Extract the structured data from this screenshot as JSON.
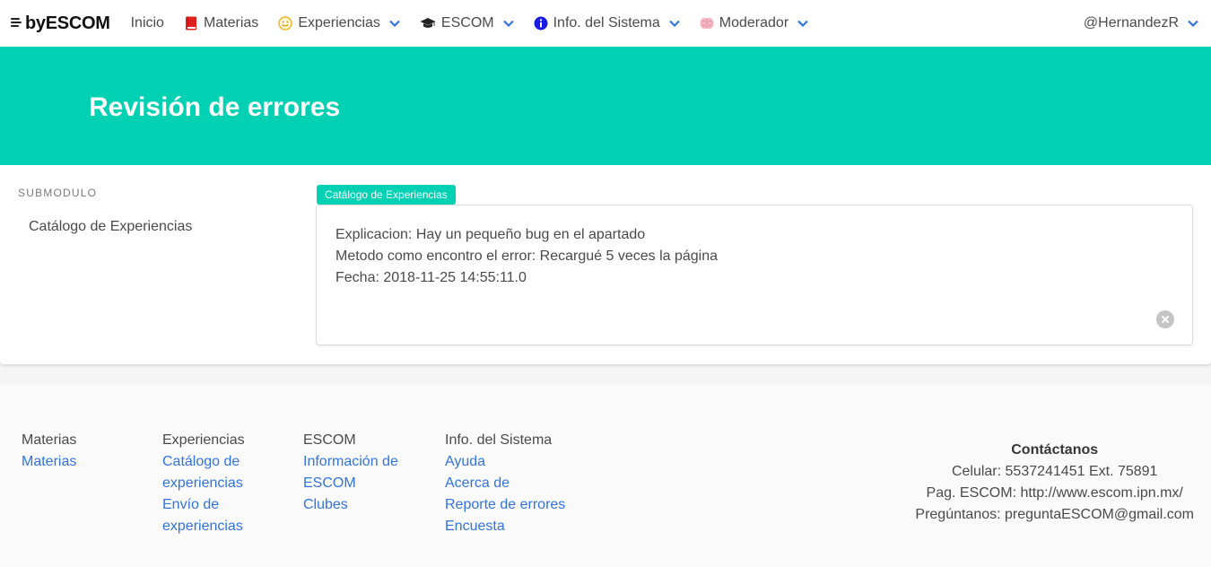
{
  "navbar": {
    "brand": "byESCOM",
    "items": [
      {
        "label": "Inicio",
        "icon": "",
        "dropdown": false
      },
      {
        "label": "Materias",
        "icon": "book-icon",
        "dropdown": false
      },
      {
        "label": "Experiencias",
        "icon": "smile-icon",
        "dropdown": true
      },
      {
        "label": "ESCOM",
        "icon": "graduation-cap-icon",
        "dropdown": true
      },
      {
        "label": "Info. del Sistema",
        "icon": "info-icon",
        "dropdown": true
      },
      {
        "label": "Moderador",
        "icon": "brain-icon",
        "dropdown": true
      }
    ],
    "user": "@HernandezR"
  },
  "hero": {
    "title": "Revisión de errores"
  },
  "sidebar": {
    "label": "SUBMODULO",
    "items": [
      {
        "label": "Catálogo de Experiencias"
      }
    ]
  },
  "report": {
    "tag": "Catálogo de Experiencias",
    "lines": [
      "Explicacion: Hay un pequeño bug en el apartado",
      "Metodo como encontro el error: Recargué 5 veces la página",
      "Fecha: 2018-11-25 14:55:11.0"
    ]
  },
  "footer": {
    "columns": [
      {
        "heading": "Materias",
        "links": [
          "Materias"
        ]
      },
      {
        "heading": "Experiencias",
        "links": [
          "Catálogo de",
          "experiencias",
          "Envío de",
          "experiencias"
        ]
      },
      {
        "heading": "ESCOM",
        "links": [
          "Información de",
          "ESCOM",
          "Clubes"
        ]
      },
      {
        "heading": "Info. del Sistema",
        "links": [
          "Ayuda",
          "Acerca de",
          "Reporte de errores",
          "Encuesta"
        ]
      }
    ],
    "contact": {
      "heading": "Contáctanos",
      "lines": [
        "Celular: 5537241451 Ext. 75891",
        "Pag. ESCOM: http://www.escom.ipn.mx/",
        "Pregúntanos: preguntaESCOM@gmail.com"
      ]
    }
  },
  "colors": {
    "primary": "#00d1b2",
    "link": "#3273dc",
    "chevron": "#3273dc"
  }
}
